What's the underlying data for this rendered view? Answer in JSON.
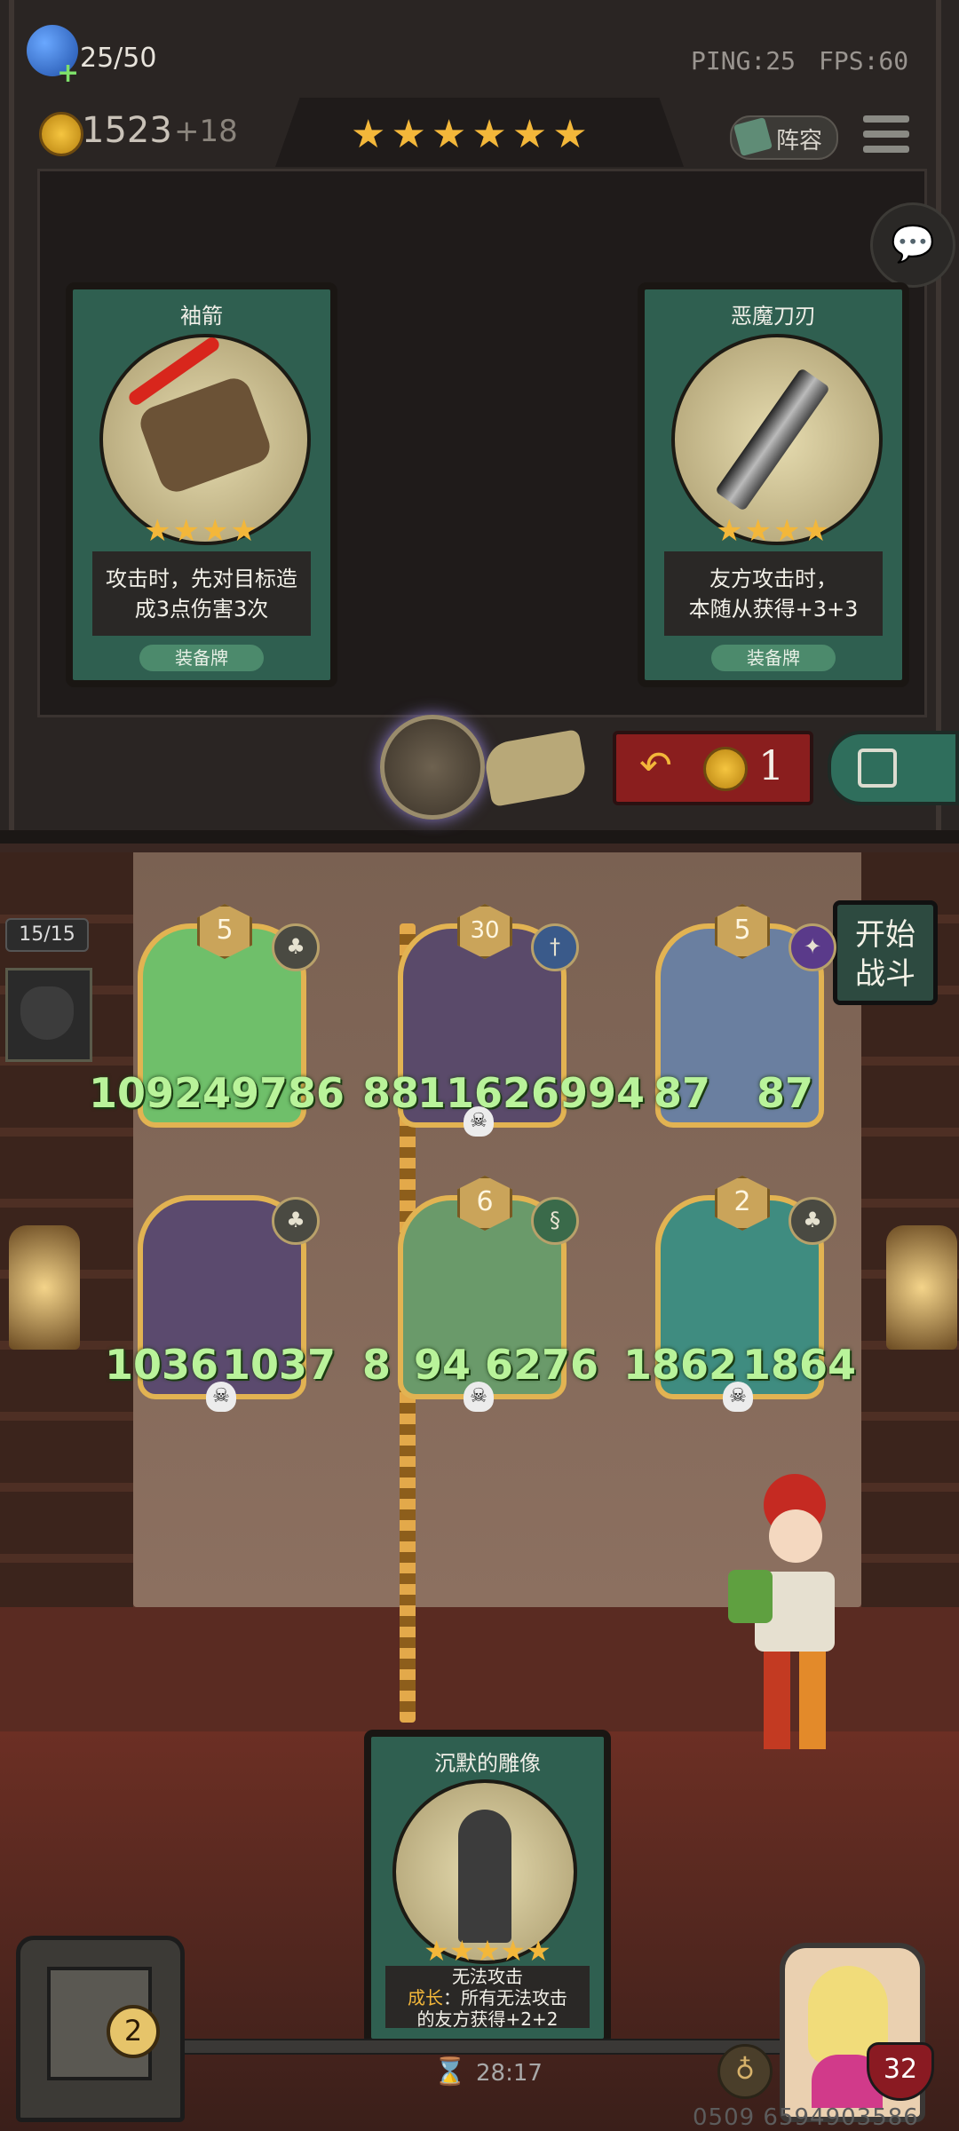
{
  "top_bar": {
    "population": "25/50",
    "ping": "PING:25",
    "fps": "FPS:60",
    "gold": "1523",
    "gold_income": "+18",
    "lineup_label": "阵容"
  },
  "shop": {
    "tier_stars": "★★★★★★",
    "cards": [
      {
        "title": "袖箭",
        "stars": "★★★★",
        "desc_line1": "攻击时，先对目标造",
        "desc_line2": "成3点伤害3次",
        "tag": "装备牌"
      },
      {
        "title": "恶魔刀刃",
        "stars": "★★★★",
        "desc_line1": "友方攻击时，",
        "desc_line2": "本随从获得+3+3",
        "tag": "装备牌"
      }
    ],
    "refresh_cost": "1"
  },
  "battle": {
    "unit_count": "15/15",
    "start_button_line1": "开始",
    "start_button_line2": "战斗",
    "units": [
      {
        "level": "5",
        "attack": "109249786",
        "health": "",
        "color": "#6fbf6a"
      },
      {
        "level": "30",
        "attack": "88",
        "health": "11626994",
        "color": "#5a4a6a"
      },
      {
        "level": "5",
        "attack": "87",
        "health": "87",
        "color": "#6a7fa0"
      },
      {
        "level": "",
        "attack": "1036",
        "health": "1037",
        "color": "#5b4a6e"
      },
      {
        "level": "6",
        "attack": "8",
        "health": "94 6276",
        "color": "#6a9a6a"
      },
      {
        "level": "2",
        "attack": "1862",
        "health": "1864",
        "color": "#3f8c80"
      }
    ]
  },
  "hand_card": {
    "title": "沉默的雕像",
    "stars": "★★★★★",
    "desc_line1": "无法攻击",
    "growth_label": "成长",
    "desc_line2": "：所有无法攻击",
    "desc_line3": "的友方获得+2+2"
  },
  "footer": {
    "timer": "28:17",
    "player_hp": "32",
    "chest_count": "2",
    "watermark": "0509 6594903586"
  }
}
